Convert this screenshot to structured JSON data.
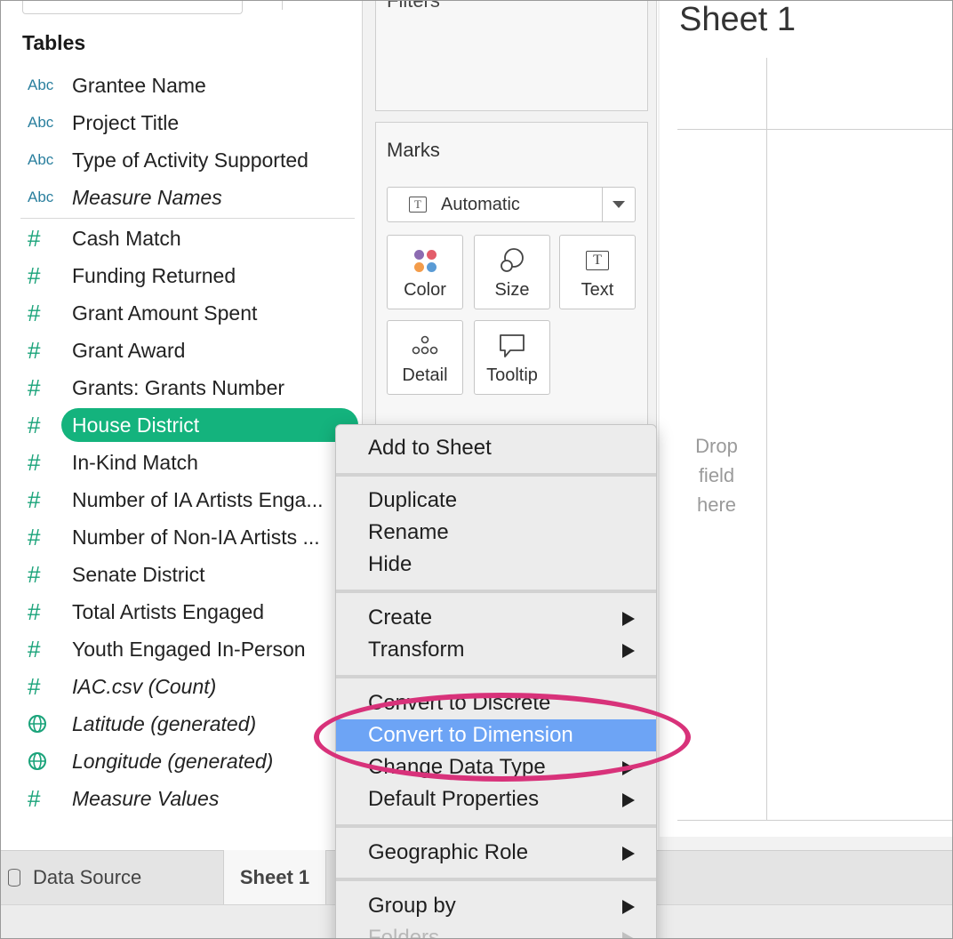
{
  "data_pane": {
    "heading": "Tables",
    "dimensions": [
      {
        "label": "Grantee Name",
        "icon": "abc-icon",
        "italic": false
      },
      {
        "label": "Project Title",
        "icon": "abc-icon",
        "italic": false
      },
      {
        "label": "Type of Activity Supported",
        "icon": "abc-icon",
        "italic": false
      },
      {
        "label": "Measure Names",
        "icon": "abc-icon",
        "italic": true
      }
    ],
    "measures": [
      {
        "label": "Cash Match",
        "icon": "number-icon"
      },
      {
        "label": "Funding Returned",
        "icon": "number-icon"
      },
      {
        "label": "Grant Amount Spent",
        "icon": "number-icon"
      },
      {
        "label": "Grant Award",
        "icon": "number-icon"
      },
      {
        "label": "Grants: Grants Number",
        "icon": "number-icon"
      },
      {
        "label": "House District",
        "icon": "number-icon",
        "selected": true
      },
      {
        "label": "In-Kind Match",
        "icon": "number-icon"
      },
      {
        "label": "Number of IA Artists Enga...",
        "icon": "number-icon"
      },
      {
        "label": "Number of Non-IA Artists ...",
        "icon": "number-icon"
      },
      {
        "label": "Senate District",
        "icon": "number-icon"
      },
      {
        "label": "Total Artists Engaged",
        "icon": "number-icon"
      },
      {
        "label": "Youth Engaged In-Person",
        "icon": "number-icon"
      },
      {
        "label": "IAC.csv (Count)",
        "icon": "number-icon",
        "italic": true
      },
      {
        "label": "Latitude (generated)",
        "icon": "globe-icon",
        "italic": true
      },
      {
        "label": "Longitude (generated)",
        "icon": "globe-icon",
        "italic": true
      },
      {
        "label": "Measure Values",
        "icon": "number-icon",
        "italic": true
      }
    ],
    "abc_glyph": "Abc",
    "number_glyph": "#"
  },
  "shelves": {
    "filters_label": "Filters",
    "marks_label": "Marks",
    "mark_type": "Automatic",
    "mark_buttons": {
      "color": "Color",
      "size": "Size",
      "text": "Text",
      "detail": "Detail",
      "tooltip": "Tooltip"
    },
    "text_glyph": "T"
  },
  "canvas": {
    "sheet_title": "Sheet 1",
    "drop_hint": [
      "Drop",
      "field",
      "here"
    ]
  },
  "tabs": {
    "data_source": "Data Source",
    "sheet1": "Sheet 1"
  },
  "context_menu": {
    "add_to_sheet": "Add to Sheet",
    "duplicate": "Duplicate",
    "rename": "Rename",
    "hide": "Hide",
    "create": "Create",
    "transform": "Transform",
    "convert_discrete": "Convert to Discrete",
    "convert_dimension": "Convert to Dimension",
    "change_type": "Change Data Type",
    "default_props": "Default Properties",
    "geo_role": "Geographic Role",
    "group_by": "Group by",
    "folders": "Folders"
  },
  "colors": {
    "selected_pill": "#14b37d",
    "menu_highlight": "#6da4f5",
    "annotation": "#d8327a",
    "measure_icon": "#1aa37a",
    "dimension_icon": "#2a7f9e"
  }
}
